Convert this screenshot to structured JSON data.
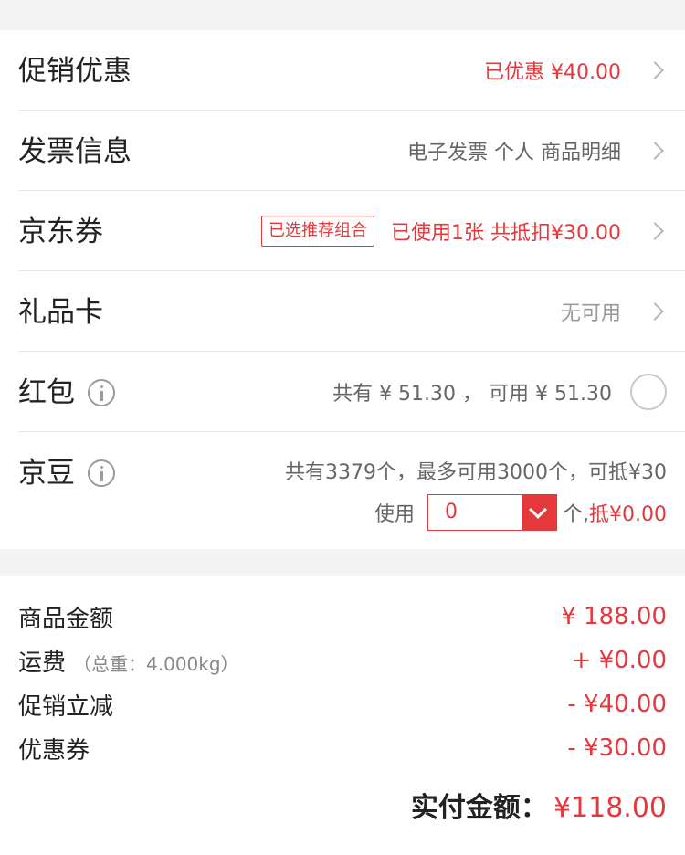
{
  "rows": {
    "promo": {
      "label": "促销优惠",
      "value": "已优惠 ¥40.00"
    },
    "invoice": {
      "label": "发票信息",
      "value": "电子发票 个人 商品明细"
    },
    "coupon": {
      "label": "京东券",
      "tag": "已选推荐组合",
      "value": "已使用1张 共抵扣¥30.00"
    },
    "giftcard": {
      "label": "礼品卡",
      "value": "无可用"
    },
    "redpacket": {
      "label": "红包",
      "value": "共有 ¥ 51.30 ， 可用 ¥ 51.30"
    },
    "beans": {
      "label": "京豆",
      "line1": "共有3379个，最多可用3000个，可抵¥30",
      "use_label": "使用",
      "use_value": "0",
      "unit": "个,",
      "deduct": "抵¥0.00"
    }
  },
  "summary": {
    "items": [
      {
        "label": "商品金额",
        "sub": "",
        "value": "¥ 188.00"
      },
      {
        "label": "运费",
        "sub": "（总重：4.000kg）",
        "value": "+ ¥0.00"
      },
      {
        "label": "促销立减",
        "sub": "",
        "value": "- ¥40.00"
      },
      {
        "label": "优惠券",
        "sub": "",
        "value": "- ¥30.00"
      }
    ],
    "total_label": "实付金额：",
    "total_value": "¥118.00"
  },
  "colors": {
    "accent": "#e4393c",
    "divider": "#e6e6e6",
    "gap": "#f4f4f4"
  }
}
